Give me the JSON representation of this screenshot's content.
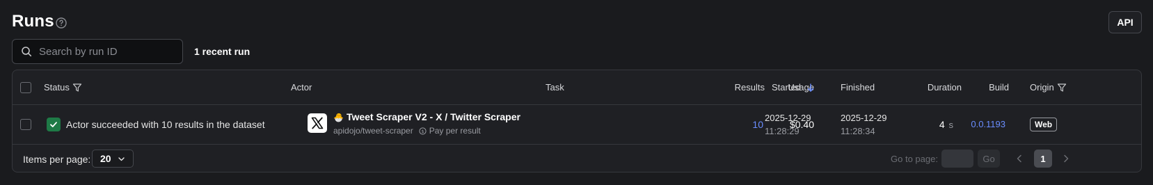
{
  "header": {
    "title": "Runs",
    "api_label": "API"
  },
  "search": {
    "placeholder": "Search by run ID",
    "value": "",
    "count_text": "1 recent run"
  },
  "table": {
    "columns": {
      "status": "Status",
      "actor": "Actor",
      "task": "Task",
      "results": "Results",
      "usage": "Usage",
      "started": "Started",
      "finished": "Finished",
      "duration": "Duration",
      "build": "Build",
      "origin": "Origin"
    },
    "rows": [
      {
        "status_text": "Actor succeeded with 10 results in the dataset",
        "status_color": "#1e7a46",
        "actor_icon": "x-logo-icon",
        "actor_emoji": "🐣",
        "actor_name": "Tweet Scraper V2 - X / Twitter Scraper",
        "actor_slug": "apidojo/tweet-scraper",
        "pricing": "Pay per result",
        "task": "",
        "results": "10",
        "usage": "$0.40",
        "started_date": "2025-12-29",
        "started_time": "11:28:29",
        "finished_date": "2025-12-29",
        "finished_time": "11:28:34",
        "duration_value": "4",
        "duration_unit": "s",
        "build": "0.0.1193",
        "origin": "Web"
      }
    ]
  },
  "footer": {
    "items_per_page_label": "Items per page:",
    "items_per_page_value": "20",
    "goto_label": "Go to page:",
    "goto_value": "",
    "go_label": "Go",
    "current_page": "1"
  },
  "colors": {
    "background": "#1a1b1e",
    "link": "#6a8dff",
    "success": "#1e7a46"
  }
}
